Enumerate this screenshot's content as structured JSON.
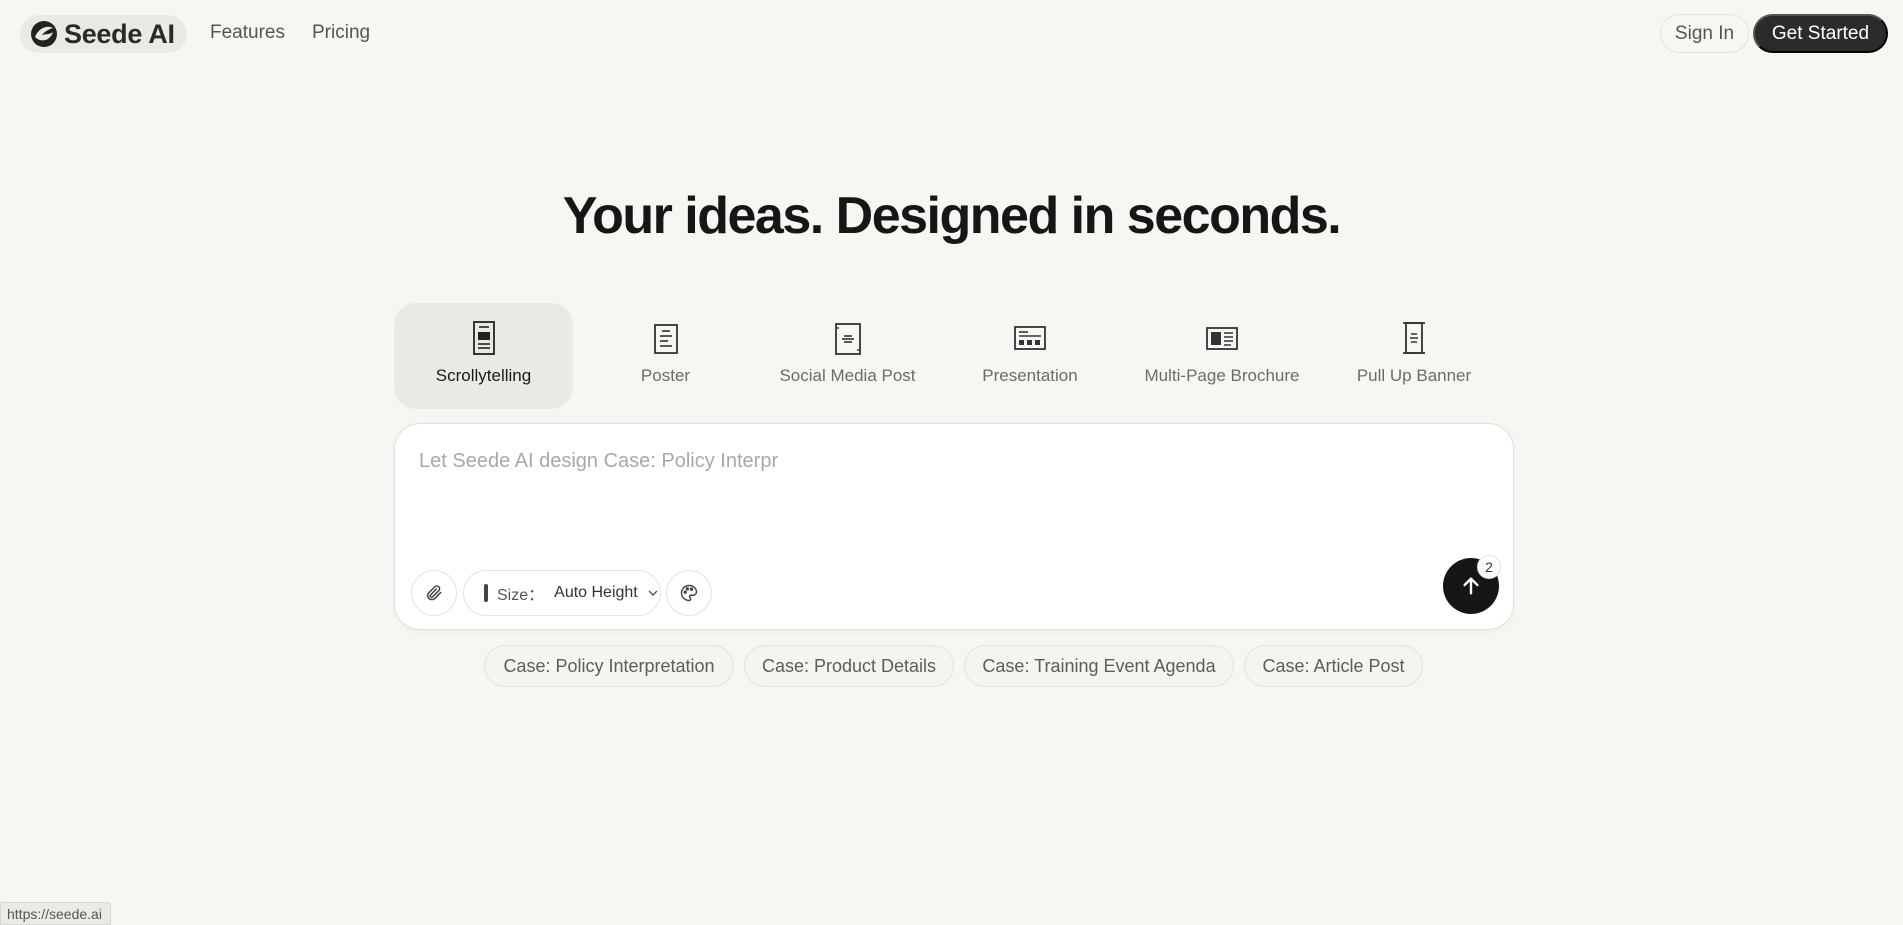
{
  "nav": {
    "brand": "Seede AI",
    "links": [
      "Features",
      "Pricing"
    ],
    "sign_in": "Sign In",
    "get_started": "Get Started"
  },
  "hero": {
    "title": "Your ideas. Designed in seconds."
  },
  "types": [
    {
      "label": "Scrollytelling",
      "icon": "scrollytelling-icon",
      "active": true
    },
    {
      "label": "Poster",
      "icon": "poster-icon",
      "active": false
    },
    {
      "label": "Social Media Post",
      "icon": "social-post-icon",
      "active": false
    },
    {
      "label": "Presentation",
      "icon": "presentation-icon",
      "active": false
    },
    {
      "label": "Multi-Page Brochure",
      "icon": "brochure-icon",
      "active": false
    },
    {
      "label": "Pull Up Banner",
      "icon": "banner-icon",
      "active": false
    }
  ],
  "prompt": {
    "placeholder": "Let Seede AI design Case: Policy Interpr",
    "value": "",
    "size_label": "Size：",
    "size_value": "Auto Height",
    "send_badge": "2"
  },
  "cases": [
    "Case: Policy Interpretation",
    "Case: Product Details",
    "Case: Training Event Agenda",
    "Case: Article Post"
  ],
  "status": {
    "url": "https://seede.ai"
  },
  "colors": {
    "background": "#f7f6f2",
    "primary_button": "#2b2b2b",
    "send_button": "#161616"
  }
}
